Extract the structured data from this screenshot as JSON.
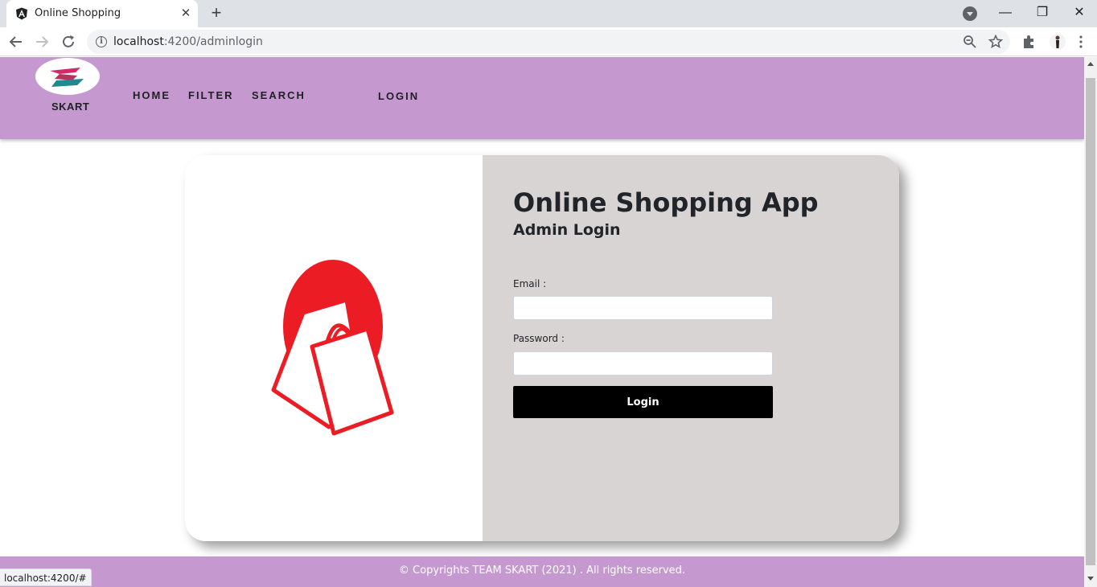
{
  "browser": {
    "tab_title": "Online Shopping",
    "url_host": "localhost",
    "url_rest": ":4200/adminlogin",
    "status_url": "localhost:4200/#"
  },
  "header": {
    "brand": "SKART",
    "nav": [
      {
        "label": "HOME"
      },
      {
        "label": "FILTER"
      },
      {
        "label": "SEARCH"
      },
      {
        "label": "LOGIN"
      }
    ]
  },
  "login": {
    "title": "Online Shopping App",
    "subtitle": "Admin Login",
    "email_label": "Email :",
    "email_value": "",
    "password_label": "Password :",
    "password_value": "",
    "button_label": "Login"
  },
  "footer": {
    "text": "© Copyrights TEAM SKART (2021) . All rights reserved."
  },
  "colors": {
    "header_bg": "#c599cf",
    "panel_bg": "#d9d4d4",
    "button_bg": "#000000",
    "logo_red": "#ec1c24"
  }
}
